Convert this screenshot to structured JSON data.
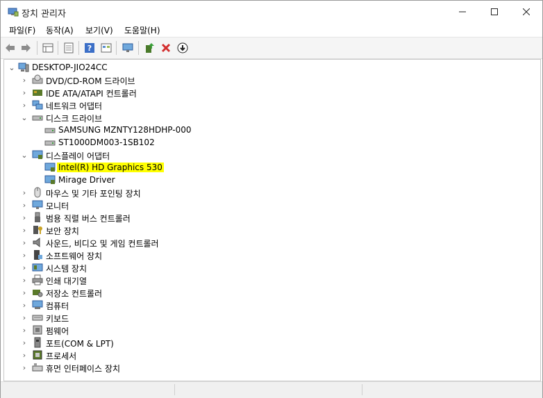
{
  "window": {
    "title": "장치 관리자"
  },
  "menu": [
    "파일(F)",
    "동작(A)",
    "보기(V)",
    "도움말(H)"
  ],
  "toolbar": [
    "back-icon",
    "forward-icon",
    "properties-grid-icon",
    "doc-icon",
    "help-icon",
    "view-icon",
    "monitor-scan-icon",
    "update-driver-icon",
    "uninstall-icon",
    "disable-icon"
  ],
  "tree": {
    "root": "DESKTOP-JIO24CC",
    "items": [
      {
        "label": "DVD/CD-ROM 드라이브",
        "icon": "dvd-icon",
        "expanded": false
      },
      {
        "label": "IDE ATA/ATAPI 컨트롤러",
        "icon": "controller-icon",
        "expanded": false
      },
      {
        "label": "네트워크 어댑터",
        "icon": "network-icon",
        "expanded": false
      },
      {
        "label": "디스크 드라이브",
        "icon": "disk-icon",
        "expanded": true,
        "children": [
          "SAMSUNG MZNTY128HDHP-000",
          "ST1000DM003-1SB102"
        ]
      },
      {
        "label": "디스플레이 어댑터",
        "icon": "display-adapter-icon",
        "expanded": true,
        "children": [
          "Intel(R) HD Graphics 530",
          "Mirage Driver"
        ]
      },
      {
        "label": "마우스 및 기타 포인팅 장치",
        "icon": "mouse-icon",
        "expanded": false
      },
      {
        "label": "모니터",
        "icon": "monitor-icon",
        "expanded": false
      },
      {
        "label": "범용 직렬 버스 컨트롤러",
        "icon": "usb-icon",
        "expanded": false
      },
      {
        "label": "보안 장치",
        "icon": "security-icon",
        "expanded": false
      },
      {
        "label": "사운드, 비디오 및 게임 컨트롤러",
        "icon": "sound-icon",
        "expanded": false
      },
      {
        "label": "소프트웨어 장치",
        "icon": "software-device-icon",
        "expanded": false
      },
      {
        "label": "시스템 장치",
        "icon": "system-icon",
        "expanded": false
      },
      {
        "label": "인쇄 대기열",
        "icon": "printer-icon",
        "expanded": false
      },
      {
        "label": "저장소 컨트롤러",
        "icon": "storage-icon",
        "expanded": false
      },
      {
        "label": "컴퓨터",
        "icon": "computer-icon",
        "expanded": false
      },
      {
        "label": "키보드",
        "icon": "keyboard-icon",
        "expanded": false
      },
      {
        "label": "펌웨어",
        "icon": "firmware-icon",
        "expanded": false
      },
      {
        "label": "포트(COM & LPT)",
        "icon": "port-icon",
        "expanded": false
      },
      {
        "label": "프로세서",
        "icon": "processor-icon",
        "expanded": false
      },
      {
        "label": "휴먼 인터페이스 장치",
        "icon": "hid-icon",
        "expanded": false
      }
    ],
    "highlight": "Intel(R) HD Graphics 530",
    "highlight_color": "#ffff00"
  }
}
